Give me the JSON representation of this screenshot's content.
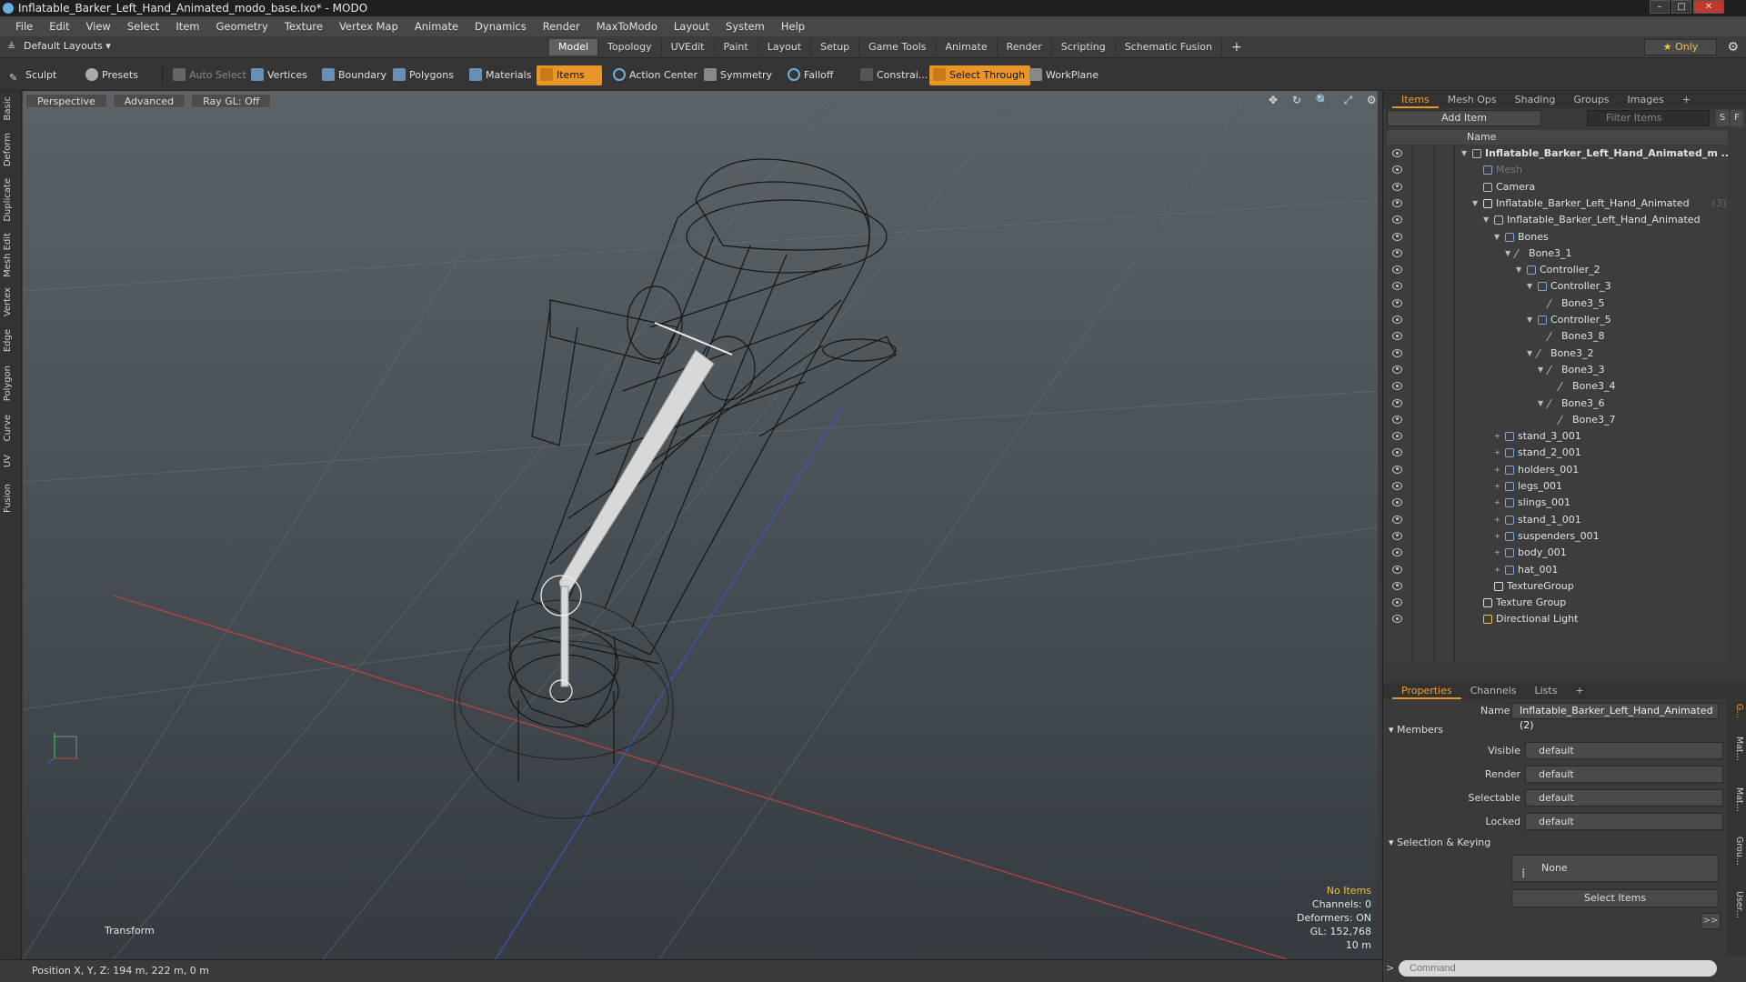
{
  "window": {
    "title": "Inflatable_Barker_Left_Hand_Animated_modo_base.lxo* - MODO",
    "min": "–",
    "max": "□",
    "close": "✕"
  },
  "menu": [
    "File",
    "Edit",
    "View",
    "Select",
    "Item",
    "Geometry",
    "Texture",
    "Vertex Map",
    "Animate",
    "Dynamics",
    "Render",
    "MaxToModo",
    "Layout",
    "System",
    "Help"
  ],
  "layoutbar": {
    "layouts_label": "Default Layouts ▾",
    "tabs": [
      "Model",
      "Topology",
      "UVEdit",
      "Paint",
      "Layout",
      "Setup",
      "Game Tools",
      "Animate",
      "Render",
      "Scripting",
      "Schematic Fusion"
    ],
    "active_tab": "Model",
    "add_tab": "+",
    "only": "★  Only"
  },
  "toolbar": {
    "sculpt": "Sculpt",
    "presets": "Presets",
    "auto_select": "Auto Select",
    "vertices": "Vertices",
    "boundary": "Boundary",
    "polygons": "Polygons",
    "materials": "Materials",
    "items": "Items",
    "action_center": "Action Center",
    "symmetry": "Symmetry",
    "falloff": "Falloff",
    "constraints": "Constrai...",
    "select_through": "Select Through",
    "workplane": "WorkPlane"
  },
  "left_tabs": [
    "Basic",
    "Deform",
    "Duplicate",
    "Mesh Edit",
    "Vertex",
    "Edge",
    "Polygon",
    "Curve",
    "UV",
    "Fusion"
  ],
  "viewport": {
    "perspective": "Perspective",
    "advanced": "Advanced",
    "raygl": "Ray GL: Off",
    "icons": "✥ ↻ 🔍 ⤢ ⚙ ▸",
    "info": {
      "no_items": "No Items",
      "channels": "Channels: 0",
      "deformers": "Deformers: ON",
      "gl": "GL: 152,768",
      "scale": "10 m"
    },
    "transform": "Transform"
  },
  "statusbar": {
    "position": "Position X, Y, Z:  194 m, 222 m, 0 m"
  },
  "items_panel": {
    "tabs": [
      "Items",
      "Mesh Ops",
      "Shading",
      "Groups",
      "Images"
    ],
    "active_tab": "Items",
    "add_tab": "+",
    "add_item": "Add Item",
    "filter": "Filter Items",
    "s_btn": "S",
    "f_btn": "F",
    "col_name": "Name",
    "rows": [
      {
        "label": "Inflatable_Barker_Left_Hand_Animated_m ...",
        "indent": 0,
        "arrow": "▼",
        "type": "scene",
        "bold": true
      },
      {
        "label": "Mesh",
        "indent": 1,
        "arrow": "",
        "type": "mesh",
        "dim": true
      },
      {
        "label": "Camera",
        "indent": 1,
        "arrow": "",
        "type": "camera"
      },
      {
        "label": "Inflatable_Barker_Left_Hand_Animated",
        "count": " (3)",
        "indent": 1,
        "arrow": "▼",
        "type": "group"
      },
      {
        "label": "Inflatable_Barker_Left_Hand_Animated",
        "indent": 2,
        "arrow": "▼",
        "type": "locator"
      },
      {
        "label": "Bones",
        "indent": 3,
        "arrow": "▼",
        "type": "mesh"
      },
      {
        "label": "Bone3_1",
        "indent": 4,
        "arrow": "▼",
        "type": "bone"
      },
      {
        "label": "Controller_2",
        "indent": 5,
        "arrow": "▼",
        "type": "mesh"
      },
      {
        "label": "Controller_3",
        "indent": 6,
        "arrow": "▼",
        "type": "mesh"
      },
      {
        "label": "Bone3_5",
        "indent": 7,
        "arrow": "",
        "type": "bone"
      },
      {
        "label": "Controller_5",
        "indent": 6,
        "arrow": "▼",
        "type": "mesh"
      },
      {
        "label": "Bone3_8",
        "indent": 7,
        "arrow": "",
        "type": "bone"
      },
      {
        "label": "Bone3_2",
        "indent": 6,
        "arrow": "▼",
        "type": "bone"
      },
      {
        "label": "Bone3_3",
        "indent": 7,
        "arrow": "▼",
        "type": "bone"
      },
      {
        "label": "Bone3_4",
        "indent": 8,
        "arrow": "",
        "type": "bone"
      },
      {
        "label": "Bone3_6",
        "indent": 7,
        "arrow": "▼",
        "type": "bone"
      },
      {
        "label": "Bone3_7",
        "indent": 8,
        "arrow": "",
        "type": "bone"
      },
      {
        "label": "stand_3_001",
        "indent": 3,
        "arrow": "+",
        "type": "mesh"
      },
      {
        "label": "stand_2_001",
        "indent": 3,
        "arrow": "+",
        "type": "mesh"
      },
      {
        "label": "holders_001",
        "indent": 3,
        "arrow": "+",
        "type": "mesh"
      },
      {
        "label": "legs_001",
        "indent": 3,
        "arrow": "+",
        "type": "mesh"
      },
      {
        "label": "slings_001",
        "indent": 3,
        "arrow": "+",
        "type": "mesh"
      },
      {
        "label": "stand_1_001",
        "indent": 3,
        "arrow": "+",
        "type": "mesh"
      },
      {
        "label": "suspenders_001",
        "indent": 3,
        "arrow": "+",
        "type": "mesh"
      },
      {
        "label": "body_001",
        "indent": 3,
        "arrow": "+",
        "type": "mesh"
      },
      {
        "label": "hat_001",
        "indent": 3,
        "arrow": "+",
        "type": "mesh"
      },
      {
        "label": "TextureGroup",
        "indent": 2,
        "arrow": "",
        "type": "texgroup"
      },
      {
        "label": "Texture Group",
        "indent": 1,
        "arrow": "",
        "type": "texgroup"
      },
      {
        "label": "Directional Light",
        "indent": 1,
        "arrow": "",
        "type": "light"
      }
    ]
  },
  "properties": {
    "tabs": [
      "Properties",
      "Channels",
      "Lists"
    ],
    "active_tab": "Properties",
    "add_tab": "+",
    "name_label": "Name",
    "name_value": "Inflatable_Barker_Left_Hand_Animated (2)",
    "members": "Members",
    "fields": [
      {
        "label": "Visible",
        "value": "default"
      },
      {
        "label": "Render",
        "value": "default"
      },
      {
        "label": "Selectable",
        "value": "default"
      },
      {
        "label": "Locked",
        "value": "default"
      }
    ],
    "selection_keying": "Selection & Keying",
    "none": "None",
    "select_items": "Select Items",
    "more": ">>",
    "side_tabs": [
      "G...",
      "Mat...",
      "Mat...",
      "Grou...",
      "User..."
    ],
    "command_prompt": ">",
    "command_placeholder": "Command"
  }
}
